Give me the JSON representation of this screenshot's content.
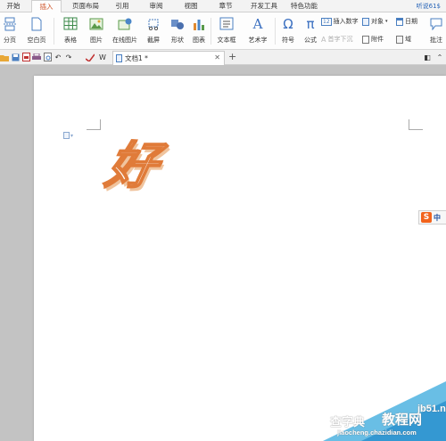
{
  "menu": {
    "tabs": [
      "开始",
      "插入",
      "页面布局",
      "引用",
      "审阅",
      "视图",
      "章节",
      "开发工具",
      "特色功能"
    ],
    "active": "插入",
    "account": "听说61$"
  },
  "ribbon": {
    "page_break": "分页",
    "blank_page": "空白页",
    "table": "表格",
    "picture": "图片",
    "online_picture": "在线图片",
    "screenshot": "截屏",
    "shapes": "形状",
    "chart": "图表",
    "textbox": "文本框",
    "wordart": "艺术字",
    "symbol": "符号",
    "equation": "公式",
    "insert_number": "插入数字",
    "object": "对象",
    "date": "日期",
    "drop_cap": "首字下沉",
    "attachment": "附件",
    "field": "域",
    "comment": "批注"
  },
  "document": {
    "tab_title": "文档1 *",
    "content_char": "好"
  },
  "ime": {
    "label": "中"
  },
  "watermark": {
    "site": "jb51.net",
    "line1": "查字典",
    "line2": "教程网",
    "url": "jiaocheng.chazidian.com"
  },
  "colors": {
    "accent": "#d0552a",
    "wordart_outline": "#e07b39",
    "ime_logo": "#f2631c"
  }
}
